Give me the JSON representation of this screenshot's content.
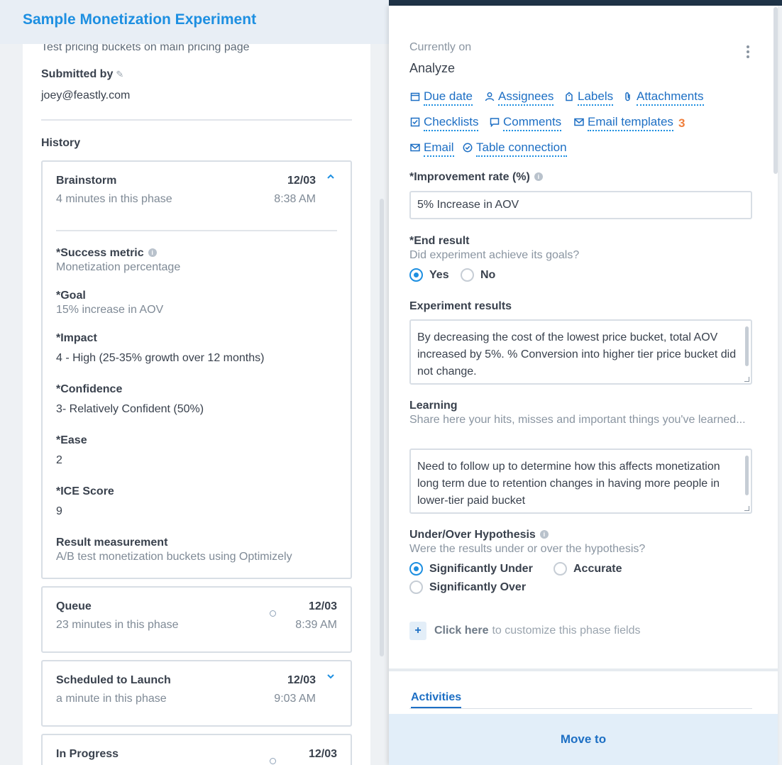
{
  "header": {
    "title": "Sample Monetization Experiment"
  },
  "left": {
    "description": "Test pricing buckets on main pricing page",
    "submitted_label": "Submitted by",
    "submitted_by": "joey@feastly.com",
    "history_label": "History",
    "cards": [
      {
        "title": "Brainstorm",
        "duration": "4 minutes in this phase",
        "date": "12/03",
        "time": "8:38 AM",
        "expanded": true,
        "fields": [
          {
            "label": "*Success metric",
            "value": "Monetization percentage"
          },
          {
            "label": "*Goal",
            "value": "15% increase in AOV"
          },
          {
            "label": "*Impact",
            "value": "4 - High (25-35% growth over 12 months)"
          },
          {
            "label": "*Confidence",
            "value": "3- Relatively Confident (50%)"
          },
          {
            "label": "*Ease",
            "value": "2"
          },
          {
            "label": "*ICE Score",
            "value": "9"
          },
          {
            "label": "Result measurement",
            "value": "A/B test monetization buckets using Optimizely"
          }
        ]
      },
      {
        "title": "Queue",
        "duration": "23 minutes in this phase",
        "date": "12/03",
        "time": "8:39 AM"
      },
      {
        "title": "Scheduled to Launch",
        "duration": "a minute in this phase",
        "date": "12/03",
        "time": "9:03 AM"
      },
      {
        "title": "In Progress",
        "duration": "",
        "date": "12/03",
        "time": ""
      }
    ]
  },
  "right": {
    "currently_on_label": "Currently on",
    "phase": "Analyze",
    "actions": {
      "due_date": "Due date",
      "assignees": "Assignees",
      "labels": "Labels",
      "attachments": "Attachments",
      "checklists": "Checklists",
      "comments": "Comments",
      "email_templates": "Email templates",
      "email_templates_count": "3",
      "email": "Email",
      "table_connection": "Table connection"
    },
    "improvement": {
      "label": "*Improvement rate (%)",
      "value": "5% Increase in AOV"
    },
    "end_result": {
      "label": "*End result",
      "help": "Did experiment achieve its goals?",
      "options": [
        "Yes",
        "No"
      ],
      "selected": "Yes"
    },
    "experiment_results": {
      "label": "Experiment results",
      "value": "By decreasing the cost of the lowest price bucket, total AOV increased by 5%. % Conversion into higher tier price bucket did not change."
    },
    "learning": {
      "label": "Learning",
      "help": "Share here your hits, misses and important things you've learned...",
      "value": "Need to follow up to determine how this affects monetization long term due to retention changes in having more people in lower-tier paid bucket"
    },
    "hypothesis": {
      "label": "Under/Over Hypothesis",
      "help": "Were the results under or over the hypothesis?",
      "options": [
        "Significantly Under",
        "Accurate",
        "Significantly Over"
      ],
      "selected": "Significantly Under"
    },
    "customize": {
      "strong": "Click here",
      "rest": "to customize this phase fields"
    },
    "activities_tab": "Activities",
    "move_to": "Move to"
  }
}
